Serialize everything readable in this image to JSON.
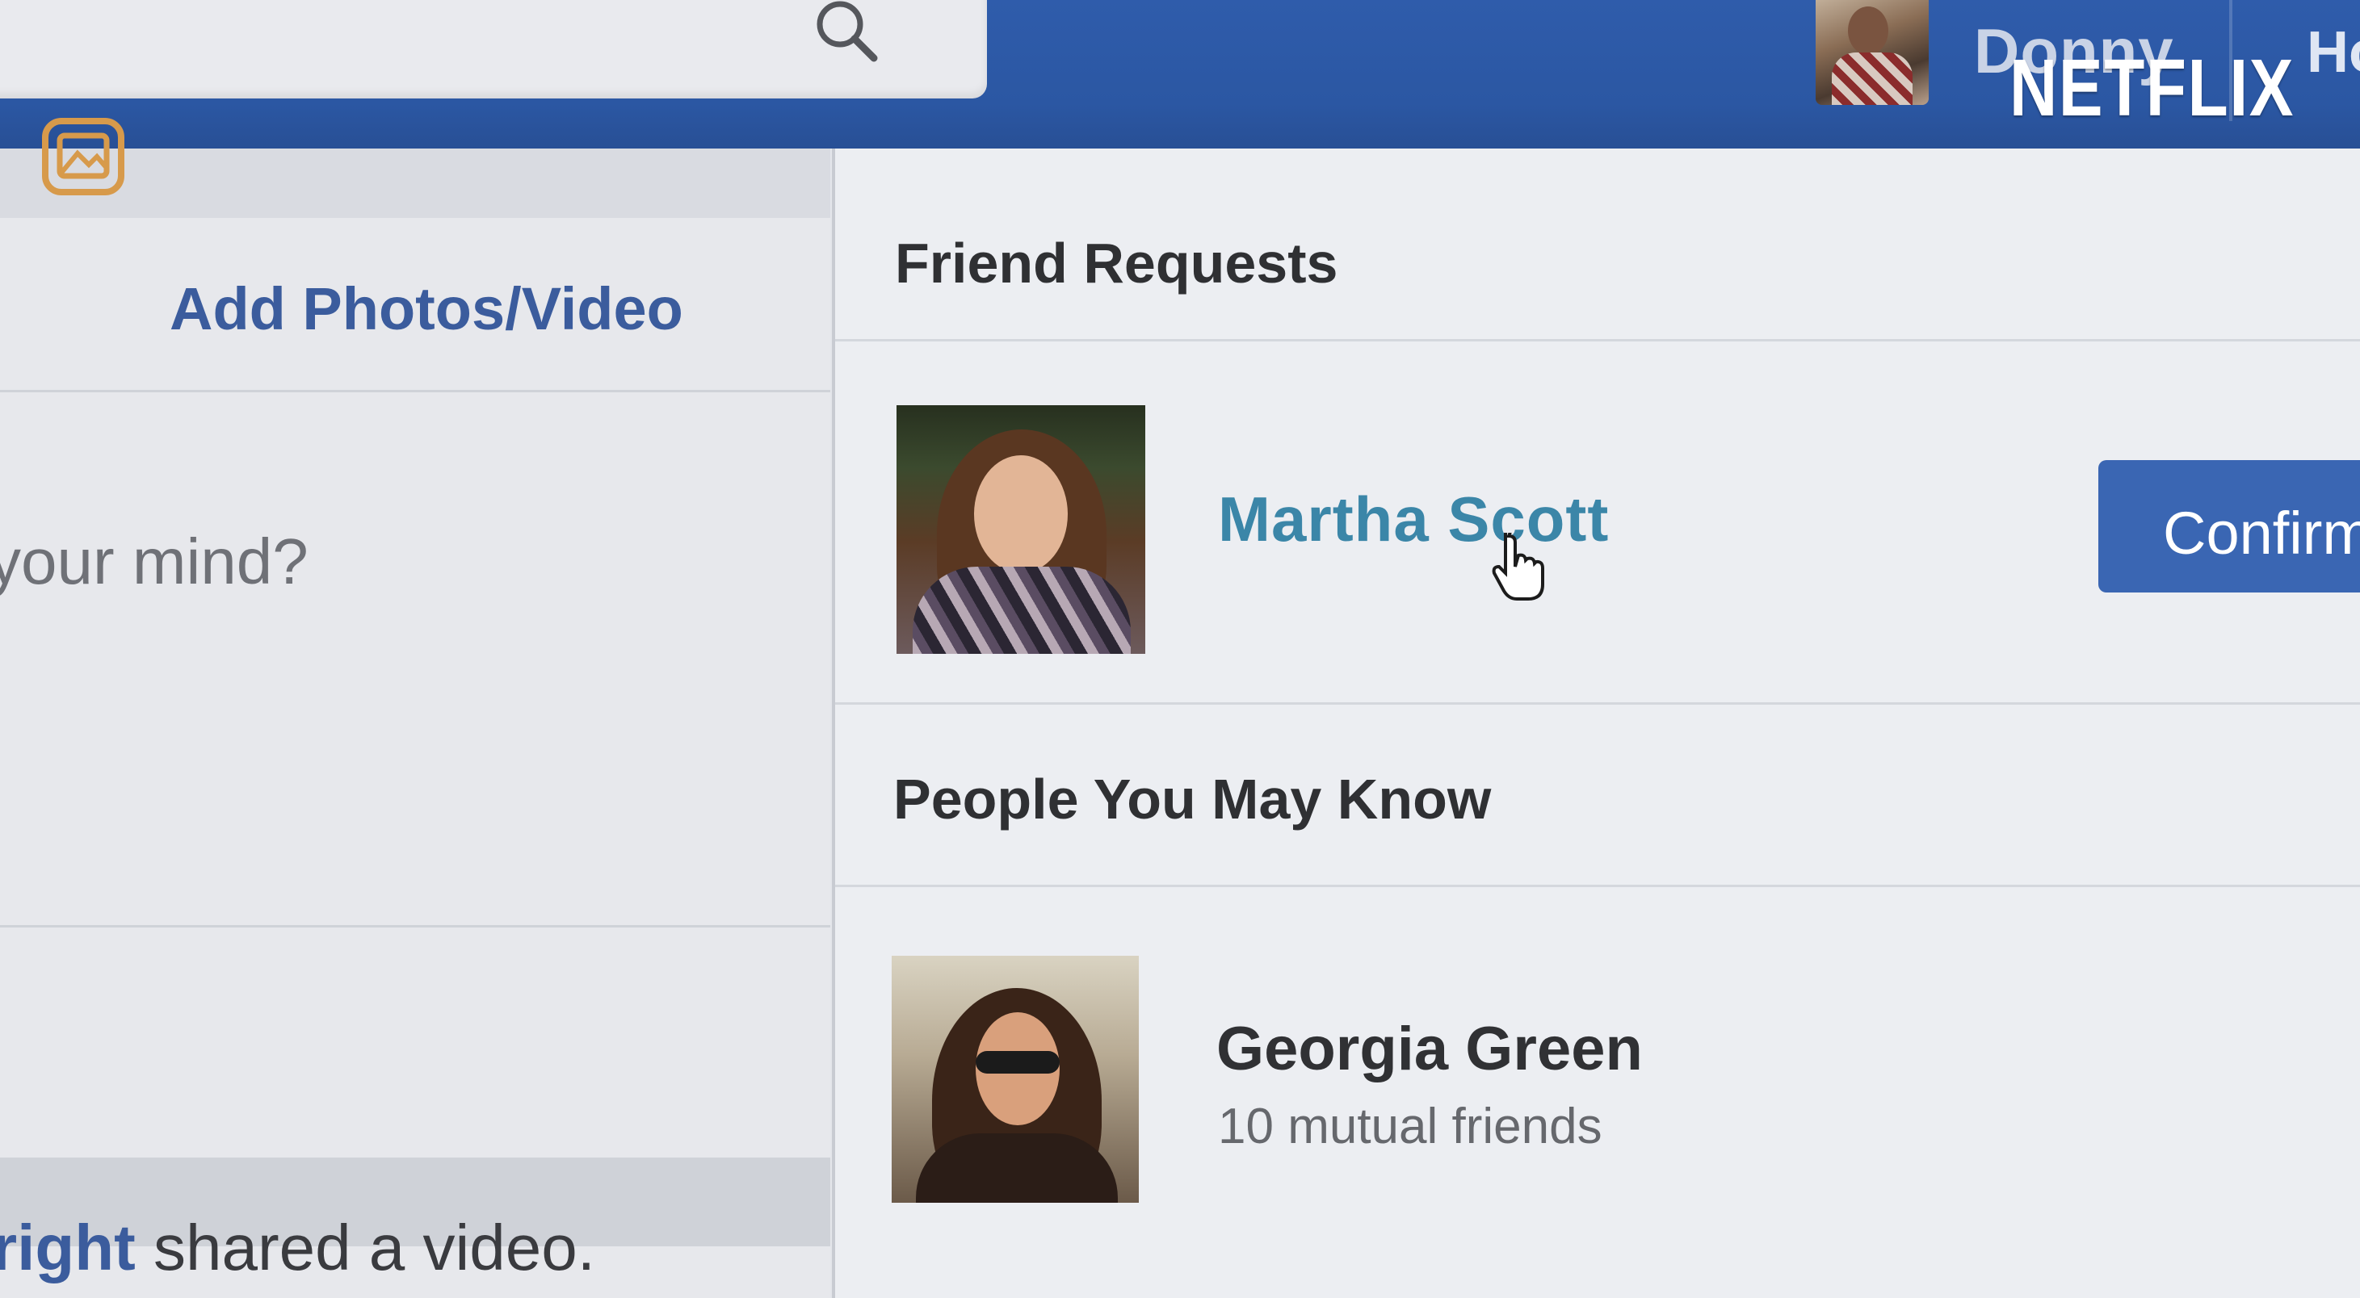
{
  "header": {
    "search": {
      "icon": "search-icon"
    },
    "user": {
      "name": "Donny",
      "avatar_icon": "profile-photo"
    },
    "home_link": "Ho",
    "watermark": "NETFLIX",
    "bar_color": "#2f5cab"
  },
  "composer": {
    "add_photos_label": "Add Photos/Video",
    "add_photos_icon": "photo-icon",
    "prompt": "your mind?"
  },
  "feed": {
    "story_actor": "right",
    "story_text": " shared a video."
  },
  "friend_requests": {
    "title": "Friend Requests",
    "items": [
      {
        "name": "Martha Scott",
        "confirm_label": "Confirm"
      }
    ]
  },
  "people_you_may_know": {
    "title": "People You May Know",
    "items": [
      {
        "name": "Georgia Green",
        "mutual": "10 mutual friends"
      }
    ]
  },
  "colors": {
    "link_blue": "#3b5c9d",
    "name_teal": "#3b86a8",
    "confirm_blue": "#3a66b3",
    "photo_icon_orange": "#d79a4b"
  }
}
